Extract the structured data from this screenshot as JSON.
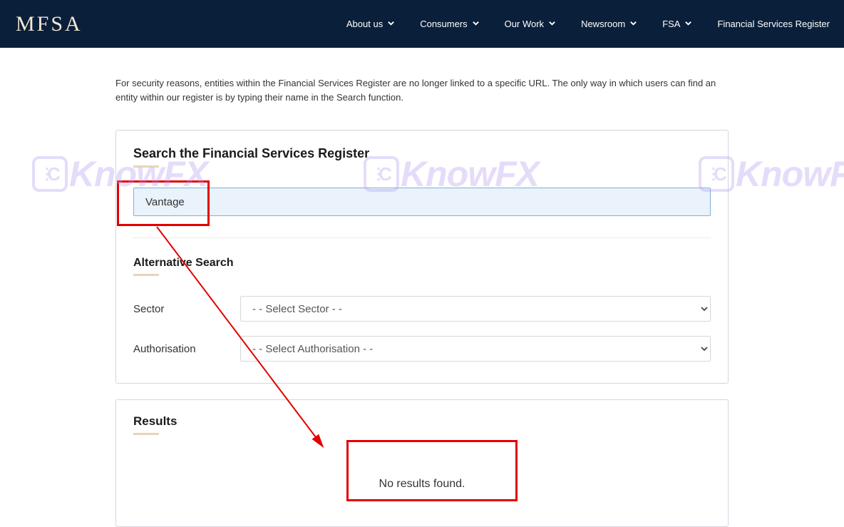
{
  "header": {
    "logo": "MFSA",
    "nav": [
      {
        "label": "About us",
        "has_dropdown": true
      },
      {
        "label": "Consumers",
        "has_dropdown": true
      },
      {
        "label": "Our Work",
        "has_dropdown": true
      },
      {
        "label": "Newsroom",
        "has_dropdown": true
      },
      {
        "label": "FSA",
        "has_dropdown": true
      },
      {
        "label": "Financial Services Register",
        "has_dropdown": false
      }
    ]
  },
  "notice": "For security reasons, entities within the Financial Services Register are no longer linked to a specific URL. The only way in which users can find an entity within our register is by typing their name in the Search function.",
  "search": {
    "title": "Search the Financial Services Register",
    "value": "Vantage"
  },
  "alternative": {
    "title": "Alternative Search",
    "fields": {
      "sector": {
        "label": "Sector",
        "placeholder": "- - Select Sector - -"
      },
      "authorisation": {
        "label": "Authorisation",
        "placeholder": "- - Select Authorisation - -"
      }
    }
  },
  "results": {
    "title": "Results",
    "message": "No results found."
  },
  "watermark": "KnowFX"
}
